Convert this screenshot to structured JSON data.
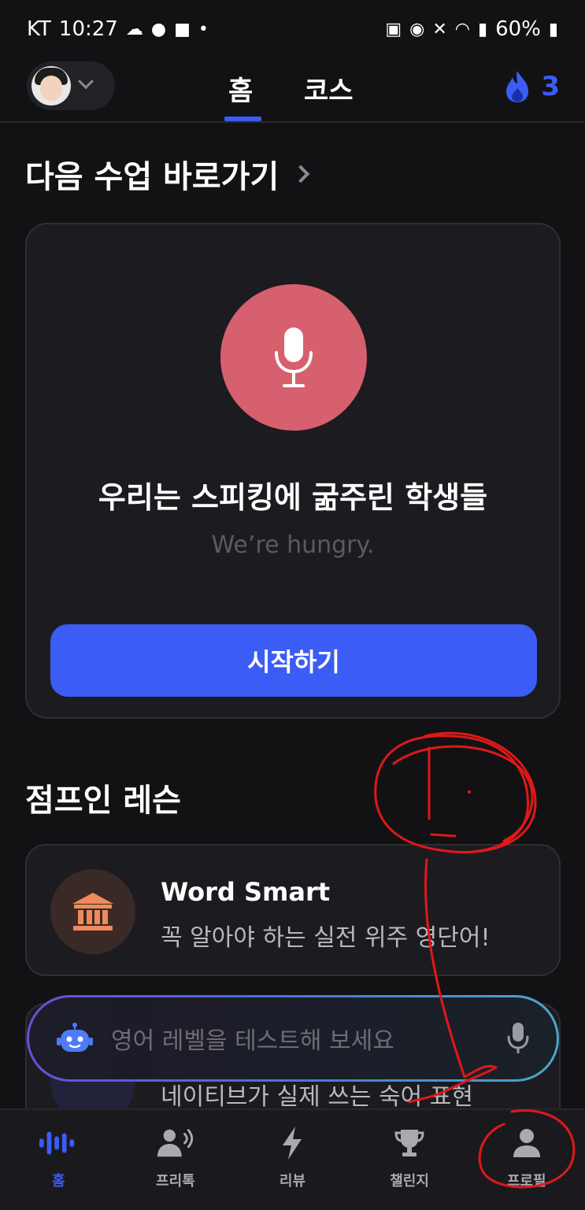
{
  "status_bar": {
    "carrier": "KT",
    "time": "10:27",
    "battery": "60%"
  },
  "top_nav": {
    "tabs": [
      {
        "label": "홈",
        "active": true
      },
      {
        "label": "코스",
        "active": false
      }
    ],
    "streak_count": "3"
  },
  "next_lesson": {
    "heading": "다음 수업 바로가기",
    "title": "우리는 스피킹에 굶주린 학생들",
    "subtitle": "We’re hungry.",
    "start_label": "시작하기"
  },
  "jump_in": {
    "heading": "점프인 레슨",
    "items": [
      {
        "title": "Word Smart",
        "subtitle": "꼭 알아야 하는 실전 위주 영단어!",
        "icon": "bank-icon"
      },
      {
        "title": "",
        "subtitle": "네이티브가 실제 쓰는 숙어 표현",
        "icon": "list-icon"
      }
    ]
  },
  "ai_bar": {
    "placeholder": "영어 레벨을 테스트해 보세요"
  },
  "bottom_nav": {
    "items": [
      {
        "label": "홈",
        "icon": "voice-wave-icon",
        "active": true
      },
      {
        "label": "프리톡",
        "icon": "speaking-person-icon",
        "active": false
      },
      {
        "label": "리뷰",
        "icon": "lightning-icon",
        "active": false
      },
      {
        "label": "챌린지",
        "icon": "trophy-icon",
        "active": false
      },
      {
        "label": "프로필",
        "icon": "profile-icon",
        "active": false
      }
    ]
  },
  "annotation": {
    "text": "1.",
    "color": "#e01818"
  },
  "colors": {
    "accent": "#3b5cf5",
    "mic_circle": "#d7606f",
    "background": "#121214",
    "card": "#1c1c20"
  }
}
